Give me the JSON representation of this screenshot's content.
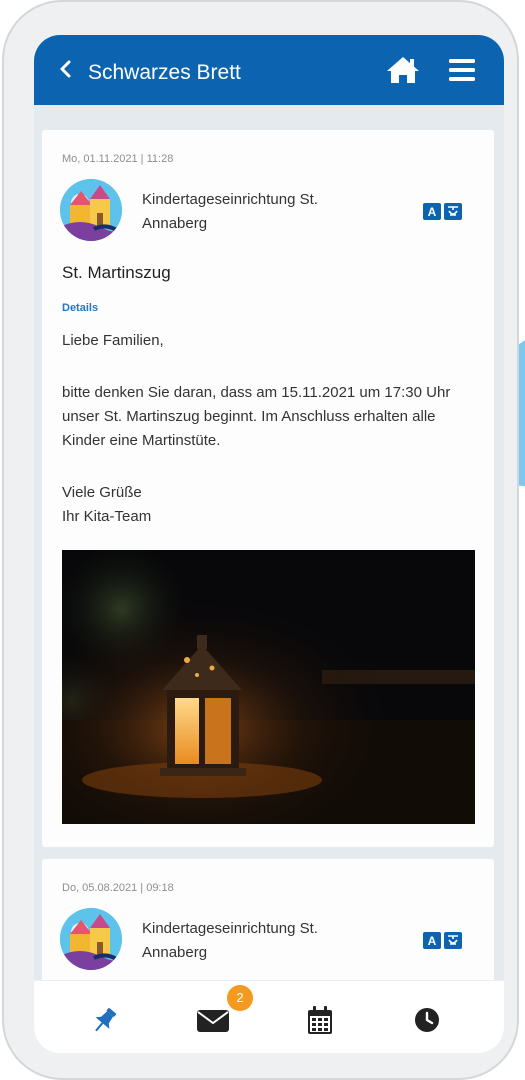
{
  "header": {
    "title": "Schwarzes Brett"
  },
  "posts": [
    {
      "timestamp": "Mo, 01.11.2021 | 11:28",
      "sender": "Kindertageseinrichtung St. Annaberg",
      "title": "St. Martinszug",
      "details_label": "Details",
      "greeting": "Liebe Familien,",
      "message": "bitte denken Sie daran, dass am 15.11.2021 um 17:30 Uhr unser St. Martinszug beginnt. Im Anschluss erhalten alle Kinder eine Martinstüte.",
      "closing_line1": "Viele Grüße",
      "closing_line2": "Ihr Kita-Team",
      "image": "lantern-photo"
    },
    {
      "timestamp": "Do, 05.08.2021 | 09:18",
      "sender": "Kindertageseinrichtung St. Annaberg"
    }
  ],
  "bottom_nav": {
    "items": [
      {
        "icon": "pin-icon",
        "active": true
      },
      {
        "icon": "mail-icon",
        "badge": "2"
      },
      {
        "icon": "calendar-icon"
      },
      {
        "icon": "clock-icon"
      }
    ]
  },
  "colors": {
    "primary": "#0c64b0",
    "active_nav": "#1f6fc0",
    "badge": "#f39a1f",
    "background": "#e5eaef"
  }
}
